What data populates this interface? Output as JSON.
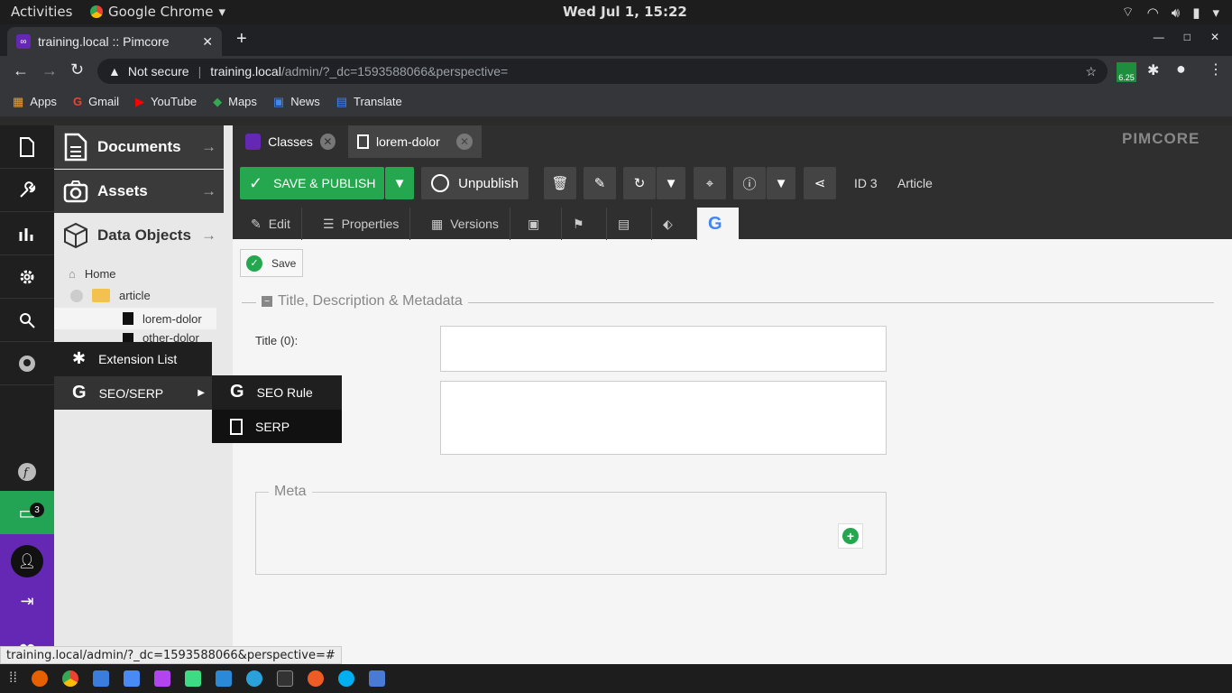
{
  "gnome": {
    "activities": "Activities",
    "app": "Google Chrome",
    "clock": "Wed Jul  1, 15:22"
  },
  "chrome": {
    "tab_title": "training.local :: Pimcore",
    "not_secure": "Not secure",
    "url_host": "training.local",
    "url_path": "/admin/?_dc=1593588066&perspective=",
    "ext_badge": "6.25"
  },
  "bookmarks": [
    {
      "label": "Apps",
      "icon": "apps-grid-icon"
    },
    {
      "label": "Gmail",
      "icon": "google-icon"
    },
    {
      "label": "YouTube",
      "icon": "youtube-icon"
    },
    {
      "label": "Maps",
      "icon": "maps-icon"
    },
    {
      "label": "News",
      "icon": "news-icon"
    },
    {
      "label": "Translate",
      "icon": "translate-icon"
    }
  ],
  "accordion": {
    "documents": "Documents",
    "assets": "Assets",
    "data_objects": "Data Objects"
  },
  "tree": {
    "home": "Home",
    "article": "article",
    "item1": "lorem-dolor",
    "item2": "other-dolor"
  },
  "tabs": {
    "classes": "Classes",
    "doc": "lorem-dolor"
  },
  "brand": "PIMCORE",
  "toolbar": {
    "save_publish": "SAVE & PUBLISH",
    "unpublish": "Unpublish",
    "id": "ID 3",
    "type": "Article"
  },
  "subtabs": {
    "edit": "Edit",
    "properties": "Properties",
    "versions": "Versions"
  },
  "seo": {
    "save": "Save",
    "section_title": "Title, Description & Metadata",
    "title_label": "Title (0):",
    "meta_legend": "Meta"
  },
  "menu": {
    "extension_list": "Extension List",
    "seo_serp": "SEO/SERP",
    "seo_rule": "SEO Rule",
    "serp": "SERP"
  },
  "notifications_count": "3",
  "status_url": "training.local/admin/?_dc=1593588066&perspective=#",
  "colors": {
    "accent_green": "#25a74f",
    "pimcore_purple": "#6428b4",
    "chat_green": "#23a455"
  }
}
